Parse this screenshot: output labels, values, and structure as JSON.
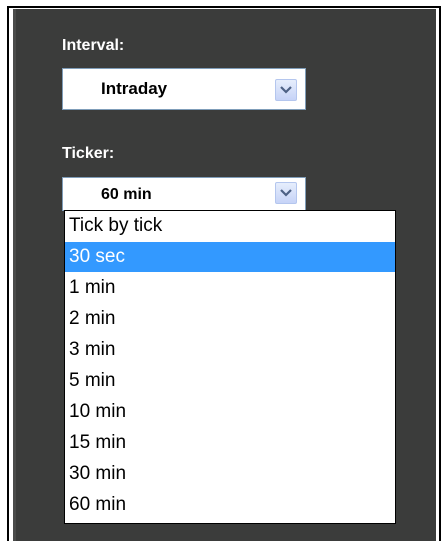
{
  "interval": {
    "label": "Interval:",
    "selected": "Intraday"
  },
  "ticker": {
    "label": "Ticker:",
    "selected": "60 min",
    "highlighted_option": "30 sec",
    "options": [
      "Tick by tick",
      "30 sec",
      "1 min",
      "2 min",
      "3 min",
      "5 min",
      "10 min",
      "15 min",
      "30 min",
      "60 min"
    ]
  },
  "icons": {
    "dropdown_arrow": "chevron-down-icon"
  },
  "colors": {
    "panel_background": "#3b3c3b",
    "highlight": "#3399ff",
    "label_text": "#ffffff",
    "arrow_button": "#c6d3f7",
    "arrow_glyph": "#4d6185"
  }
}
